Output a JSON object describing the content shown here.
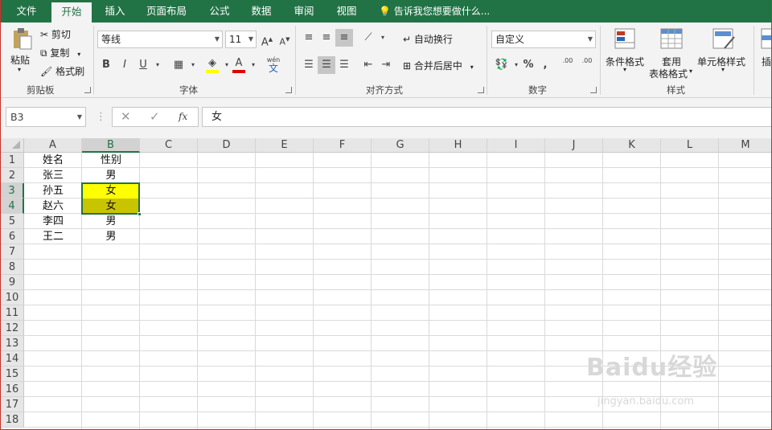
{
  "tabs": [
    "文件",
    "开始",
    "插入",
    "页面布局",
    "公式",
    "数据",
    "审阅",
    "视图"
  ],
  "tell_me": "告诉我您想要做什么...",
  "clipboard": {
    "paste": "粘贴",
    "cut": "剪切",
    "copy": "复制",
    "format_painter": "格式刷",
    "label": "剪贴板"
  },
  "font": {
    "name": "等线",
    "size": "11",
    "bold": "B",
    "italic": "I",
    "underline": "U",
    "label": "字体",
    "wen": "wén",
    "wen_char": "文"
  },
  "alignment": {
    "wrap": "自动换行",
    "merge": "合并后居中",
    "label": "对齐方式"
  },
  "number": {
    "format": "自定义",
    "label": "数字",
    "percent": "%",
    "comma": ",",
    "inc_decimal": ".00",
    "dec_decimal": ".00"
  },
  "styles": {
    "conditional": "条件格式",
    "table1": "套用",
    "table2": "表格格式",
    "cell_styles": "单元格样式",
    "label": "样式",
    "insert": "插"
  },
  "formula_bar": {
    "name_box": "B3",
    "fx": "fx",
    "content": "女"
  },
  "grid": {
    "columns": [
      "A",
      "B",
      "C",
      "D",
      "E",
      "F",
      "G",
      "H",
      "I",
      "J",
      "K",
      "L",
      "M"
    ],
    "rows": [
      "1",
      "2",
      "3",
      "4",
      "5",
      "6",
      "7",
      "8",
      "9",
      "10",
      "11",
      "12",
      "13",
      "14",
      "15",
      "16",
      "17",
      "18"
    ],
    "colA": [
      "姓名",
      "张三",
      "孙五",
      "赵六",
      "李四",
      "王二"
    ],
    "colB": [
      "性别",
      "男",
      "女",
      "女",
      "男",
      "男"
    ],
    "highlight_b3": "#ffff00",
    "highlight_b4": "#c9c400"
  },
  "watermark": {
    "brand": "Baidu经验",
    "url": "jingyan.baidu.com"
  },
  "accent": "#217346"
}
